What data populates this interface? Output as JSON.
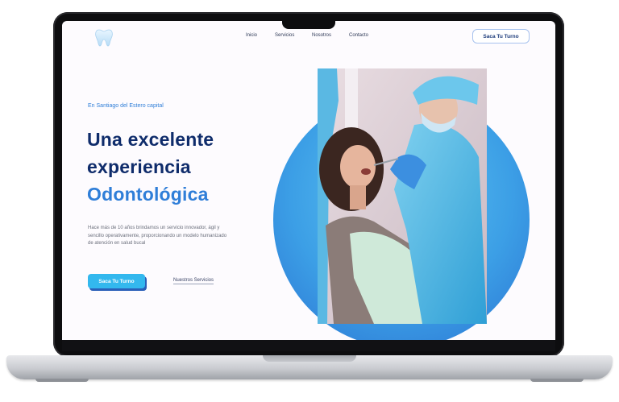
{
  "site": {
    "nav": [
      {
        "label": "Inicio"
      },
      {
        "label": "Servicios"
      },
      {
        "label": "Nosotros"
      },
      {
        "label": "Contacto"
      }
    ],
    "header_cta": "Saca Tu Turno"
  },
  "hero": {
    "eyebrow": "En Santiago del Estero capital",
    "headline_line1": "Una excelente",
    "headline_line2": "experiencia",
    "headline_line3": "Odontológica",
    "description": "Hace más de 10 años brindamos un servicio innovador, ágil y sencillo operativamente, proporcionando un modelo humanizado de atención en salud bucal",
    "primary_cta": "Saca Tu Turno",
    "secondary_link": "Nuestros Servicios"
  },
  "icons": {
    "logo": "tooth-icon"
  },
  "colors": {
    "brand_dark": "#0f2c6b",
    "brand_accent": "#2f7ed8",
    "button_primary": "#33b8ee",
    "circle": "#3c9fe6"
  }
}
